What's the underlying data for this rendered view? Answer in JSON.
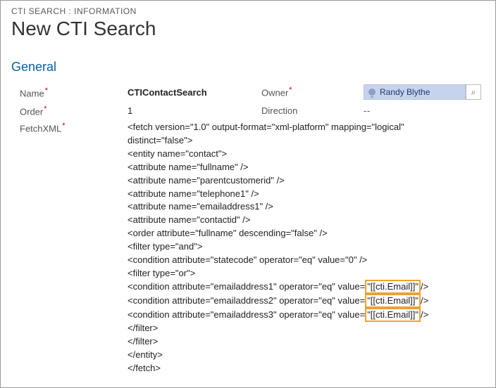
{
  "breadcrumb": "CTI SEARCH : INFORMATION",
  "page_title": "New CTI Search",
  "section": "General",
  "fields": {
    "name_label": "Name",
    "name_value": "CTIContactSearch",
    "order_label": "Order",
    "order_value": "1",
    "owner_label": "Owner",
    "owner_value": "Randy Blythe",
    "direction_label": "Direction",
    "direction_value": "--",
    "fetchxml_label": "FetchXML"
  },
  "fetchxml": {
    "l1": "<fetch version=\"1.0\" output-format=\"xml-platform\" mapping=\"logical\" distinct=\"false\">",
    "l2": "<entity name=\"contact\">",
    "l3": "<attribute name=\"fullname\" />",
    "l4": "<attribute name=\"parentcustomerid\" />",
    "l5": "<attribute name=\"telephone1\" />",
    "l6": "<attribute name=\"emailaddress1\" />",
    "l7": "<attribute name=\"contactid\" />",
    "l8": "<order attribute=\"fullname\" descending=\"false\" />",
    "l9": "<filter type=\"and\">",
    "l10": "<condition attribute=\"statecode\" operator=\"eq\" value=\"0\" />",
    "l11": "<filter type=\"or\">",
    "l12a": " <condition attribute=\"emailaddress1\" operator=\"eq\" value=",
    "l12b": "\"[[cti.Email]]\"",
    "l12c": "/>",
    "l13a": " <condition attribute=\"emailaddress2\" operator=\"eq\" value=",
    "l13b": "\"[[cti.Email]]\"",
    "l13c": "/>",
    "l14a": " <condition attribute=\"emailaddress3\" operator=\"eq\" value=",
    "l14b": "\"[[cti.Email]]\"",
    "l14c": "/>",
    "l15": "</filter>",
    "l16": "</filter>",
    "l17": "</entity>",
    "l18": "</fetch>"
  }
}
